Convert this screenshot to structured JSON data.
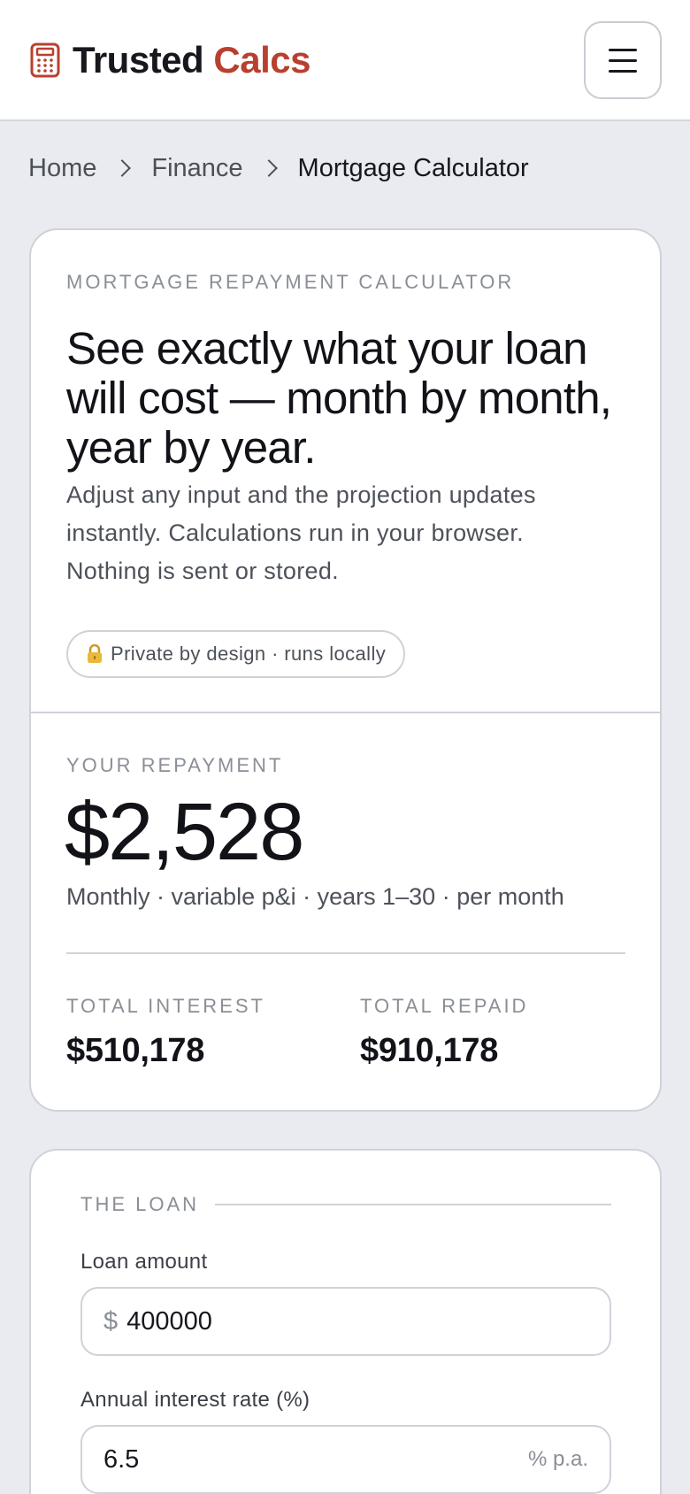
{
  "header": {
    "brand_primary": "Trusted",
    "brand_accent": "Calcs",
    "accent_color": "#b8402f",
    "logo_icon": "calculator-icon",
    "menu_icon": "hamburger-menu-icon"
  },
  "breadcrumb": {
    "items": [
      "Home",
      "Finance"
    ],
    "current": "Mortgage Calculator"
  },
  "hero": {
    "eyebrow": "MORTGAGE REPAYMENT CALCULATOR",
    "title": "See exactly what your loan will cost — month by month, year by year.",
    "description": "Adjust any input and the projection updates instantly. Calculations run in your browser. Nothing is sent or stored.",
    "privacy_badge": "Private by design · runs locally",
    "privacy_icon": "lock-icon"
  },
  "repayment": {
    "label": "YOUR REPAYMENT",
    "amount": "$2,528",
    "summary": "Monthly · variable p&i · years 1–30 · per month",
    "total_interest_label": "TOTAL INTEREST",
    "total_interest": "$510,178",
    "total_repaid_label": "TOTAL REPAID",
    "total_repaid": "$910,178"
  },
  "loan": {
    "section_label": "THE LOAN",
    "loan_amount_label": "Loan amount",
    "loan_amount_prefix": "$",
    "loan_amount_value": "400000",
    "rate_label": "Annual interest rate (%)",
    "rate_value": "6.5",
    "rate_suffix": "% p.a."
  }
}
